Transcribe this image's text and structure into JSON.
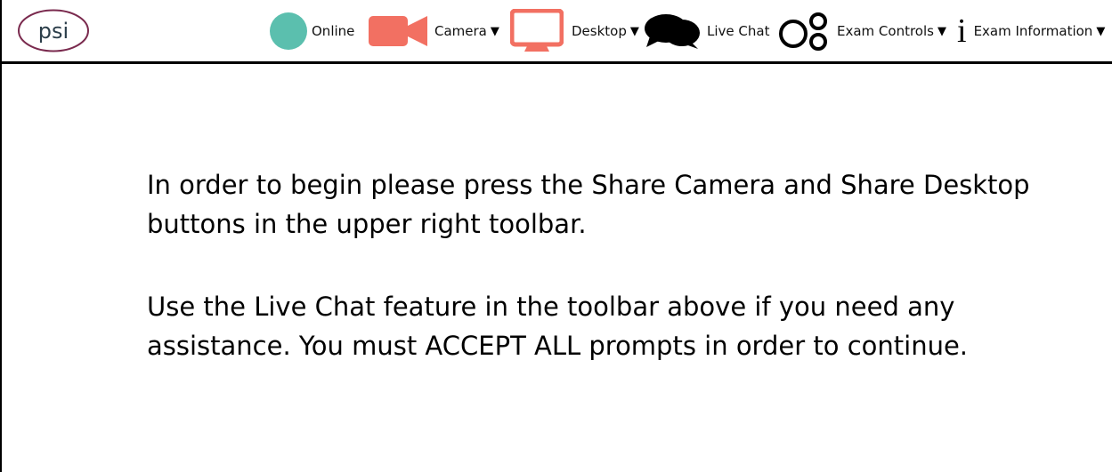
{
  "logo": {
    "text": "psi"
  },
  "toolbar": {
    "online_label": "Online",
    "camera_label": "Camera",
    "desktop_label": "Desktop",
    "livechat_label": "Live Chat",
    "exam_controls_label": "Exam Controls",
    "exam_info_label": "Exam Information",
    "dropdown_caret": "▼",
    "info_glyph": "i"
  },
  "colors": {
    "online_status": "#5bbfae",
    "camera_icon": "#f27062",
    "desktop_icon": "#f27062",
    "chat_icon": "#000000",
    "logo_ring": "#7a2a4e"
  },
  "icons": {
    "online": "status-circle-icon",
    "camera": "video-camera-icon",
    "desktop": "monitor-icon",
    "chat": "chat-bubbles-icon",
    "exam_controls": "controls-circles-icon",
    "exam_info": "info-icon"
  },
  "message": {
    "paragraph1": "In order to begin please press the Share Camera and Share Desktop buttons in the upper right toolbar.",
    "paragraph2": "Use the Live Chat feature in the toolbar above if you need any assistance. You must ACCEPT ALL prompts in order to continue."
  }
}
